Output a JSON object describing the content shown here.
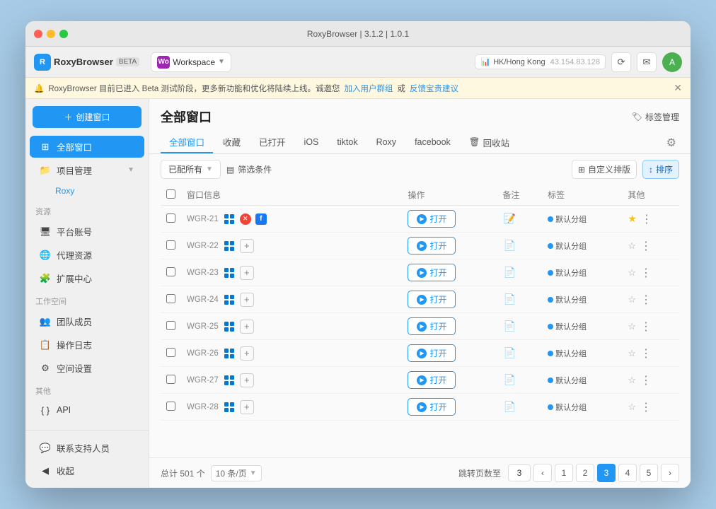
{
  "window": {
    "title": "RoxyBrowser | 3.1.2 | 1.0.1"
  },
  "titlebar": {
    "title": "RoxyBrowser | 3.1.2 | 1.0.1"
  },
  "navbar": {
    "brand_name": "RoxyBrowser",
    "brand_beta": "BETA",
    "workspace_label": "Workspace",
    "location": "HK/Hong Kong",
    "ip": "43.154.83.128"
  },
  "announce": {
    "text": "RoxyBrowser 目前已进入 Beta 测试阶段，更多新功能和优化将陆续上线。诚邀您",
    "join_link": "加入用户群组",
    "or": "或",
    "feedback_link": "反馈宝贵建议"
  },
  "sidebar": {
    "create_btn": "创建窗口",
    "main_items": [
      {
        "id": "all-windows",
        "label": "全部窗口",
        "active": true
      },
      {
        "id": "project-mgmt",
        "label": "项目管理",
        "expandable": true
      }
    ],
    "sub_items": [
      {
        "id": "roxy",
        "label": "Roxy"
      }
    ],
    "resource_section": "资源",
    "resource_items": [
      {
        "id": "platform-account",
        "label": "平台账号"
      },
      {
        "id": "proxy-resources",
        "label": "代理资源"
      },
      {
        "id": "extensions",
        "label": "扩展中心"
      }
    ],
    "workspace_section": "工作空间",
    "workspace_items": [
      {
        "id": "team-members",
        "label": "团队成员"
      },
      {
        "id": "operation-log",
        "label": "操作日志"
      },
      {
        "id": "space-settings",
        "label": "空间设置"
      }
    ],
    "other_section": "其他",
    "other_items": [
      {
        "id": "api",
        "label": "API"
      }
    ],
    "bottom_items": [
      {
        "id": "contact-support",
        "label": "联系支持人员"
      },
      {
        "id": "collapse",
        "label": "收起"
      }
    ]
  },
  "content": {
    "title": "全部窗口",
    "tag_mgmt": "标签管理",
    "tabs": [
      {
        "id": "all",
        "label": "全部窗口",
        "active": true
      },
      {
        "id": "favorites",
        "label": "收藏"
      },
      {
        "id": "open",
        "label": "已打开"
      },
      {
        "id": "ios",
        "label": "iOS"
      },
      {
        "id": "tiktok",
        "label": "tiktok"
      },
      {
        "id": "roxy",
        "label": "Roxy"
      },
      {
        "id": "facebook",
        "label": "facebook"
      },
      {
        "id": "recycle",
        "label": "回收站"
      }
    ],
    "filter_assign": "已配所有",
    "filter_conditions": "筛选条件",
    "custom_cols": "自定义排版",
    "sort": "排序",
    "columns": {
      "window_info": "窗口信息",
      "operations": "操作",
      "notes": "备注",
      "tags": "标签",
      "others": "其他"
    },
    "rows": [
      {
        "id": "WGR-21",
        "has_windows_icon": true,
        "has_red_circle": true,
        "has_fb": true,
        "open_btn": "打开",
        "has_note": true,
        "note_blue": true,
        "tag": "默认分组",
        "has_star": true,
        "star": true
      },
      {
        "id": "WGR-22",
        "has_windows_icon": true,
        "has_red_circle": false,
        "has_fb": false,
        "open_btn": "打开",
        "has_note": true,
        "note_blue": false,
        "tag": "默认分组",
        "has_star": false
      },
      {
        "id": "WGR-23",
        "has_windows_icon": true,
        "has_red_circle": false,
        "has_fb": false,
        "open_btn": "打开",
        "has_note": true,
        "note_blue": false,
        "tag": "默认分组",
        "has_star": false
      },
      {
        "id": "WGR-24",
        "has_windows_icon": true,
        "has_red_circle": false,
        "has_fb": false,
        "open_btn": "打开",
        "has_note": true,
        "note_blue": false,
        "tag": "默认分组",
        "has_star": false
      },
      {
        "id": "WGR-25",
        "has_windows_icon": true,
        "has_red_circle": false,
        "has_fb": false,
        "open_btn": "打开",
        "has_note": true,
        "note_blue": false,
        "tag": "默认分组",
        "has_star": false
      },
      {
        "id": "WGR-26",
        "has_windows_icon": true,
        "has_red_circle": false,
        "has_fb": false,
        "open_btn": "打开",
        "has_note": true,
        "note_blue": false,
        "tag": "默认分组",
        "has_star": false
      },
      {
        "id": "WGR-27",
        "has_windows_icon": true,
        "has_red_circle": false,
        "has_fb": false,
        "open_btn": "打开",
        "has_note": true,
        "note_blue": false,
        "tag": "默认分组",
        "has_star": false
      },
      {
        "id": "WGR-28",
        "has_windows_icon": true,
        "has_red_circle": false,
        "has_fb": false,
        "open_btn": "打开",
        "has_note": true,
        "note_blue": false,
        "tag": "默认分组",
        "has_star": false
      }
    ],
    "footer": {
      "total_label": "总计 501 个",
      "per_page": "10 条/页",
      "goto_page": "跳转页数至",
      "current_page": 3,
      "pages": [
        1,
        2,
        3,
        4,
        5
      ]
    }
  }
}
